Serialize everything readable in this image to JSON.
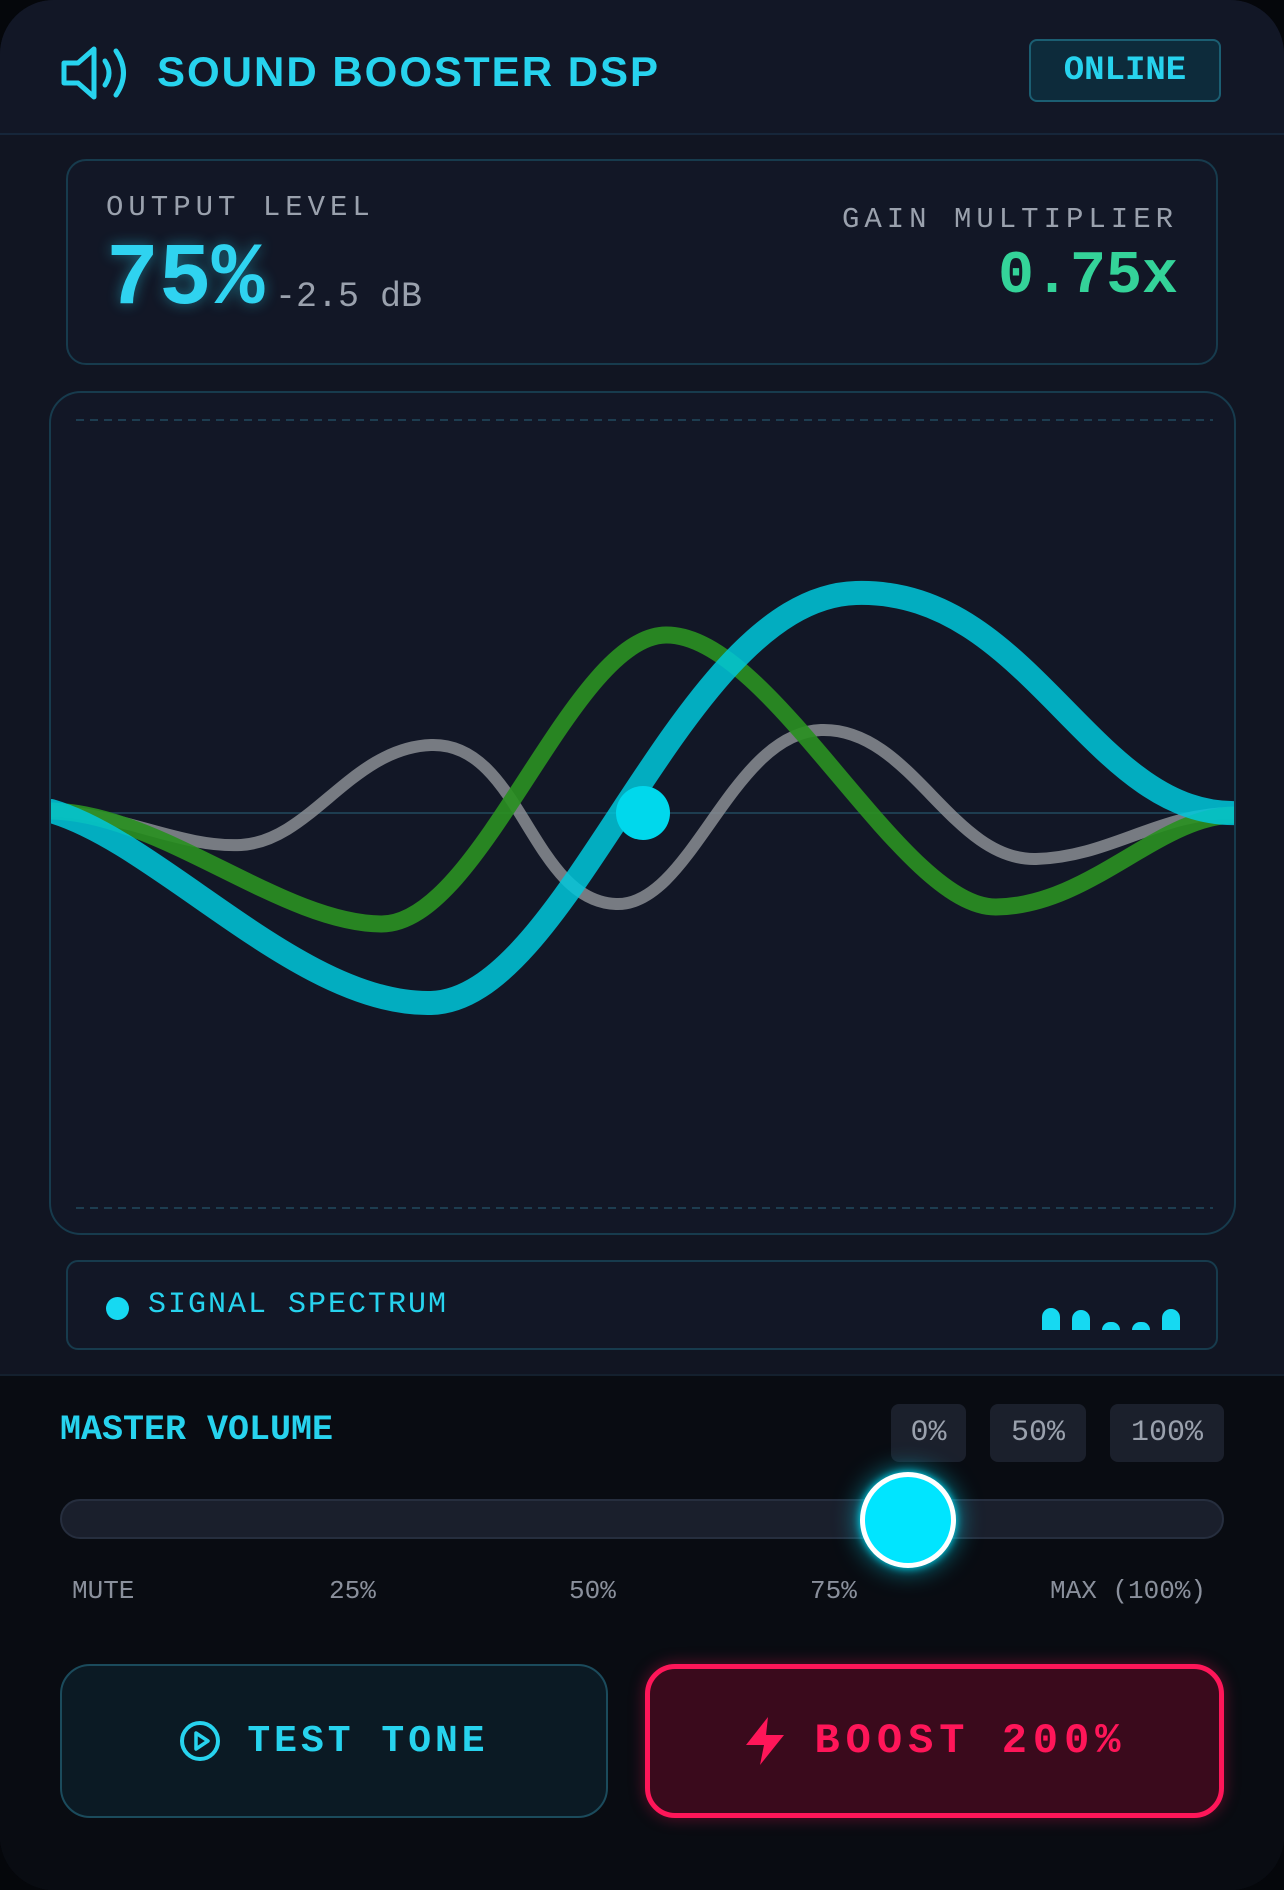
{
  "header": {
    "title": "SOUND BOOSTER DSP",
    "status": "ONLINE",
    "icon": "speaker-icon"
  },
  "readout": {
    "output_label": "OUTPUT LEVEL",
    "output_value": "75%",
    "output_db": "-2.5 dB",
    "gain_label": "GAIN MULTIPLIER",
    "gain_value": "0.75x"
  },
  "spectrum": {
    "label": "SIGNAL SPECTRUM",
    "bar_levels": [
      0.8,
      0.7,
      0.25,
      0.25,
      0.75
    ]
  },
  "volume": {
    "label": "MASTER VOLUME",
    "presets": [
      "0%",
      "50%",
      "100%"
    ],
    "value": 0.75,
    "ticks": [
      "MUTE",
      "25%",
      "50%",
      "75%",
      "MAX (100%)"
    ]
  },
  "buttons": {
    "test_tone": "TEST TONE",
    "boost": "BOOST 200%"
  },
  "colors": {
    "accent": "#27d3ee",
    "gain": "#34d399",
    "boost": "#ff1659",
    "wave_primary": "#00c8dc",
    "wave_secondary": "#2a8f22",
    "wave_tertiary": "#8a8d93"
  }
}
